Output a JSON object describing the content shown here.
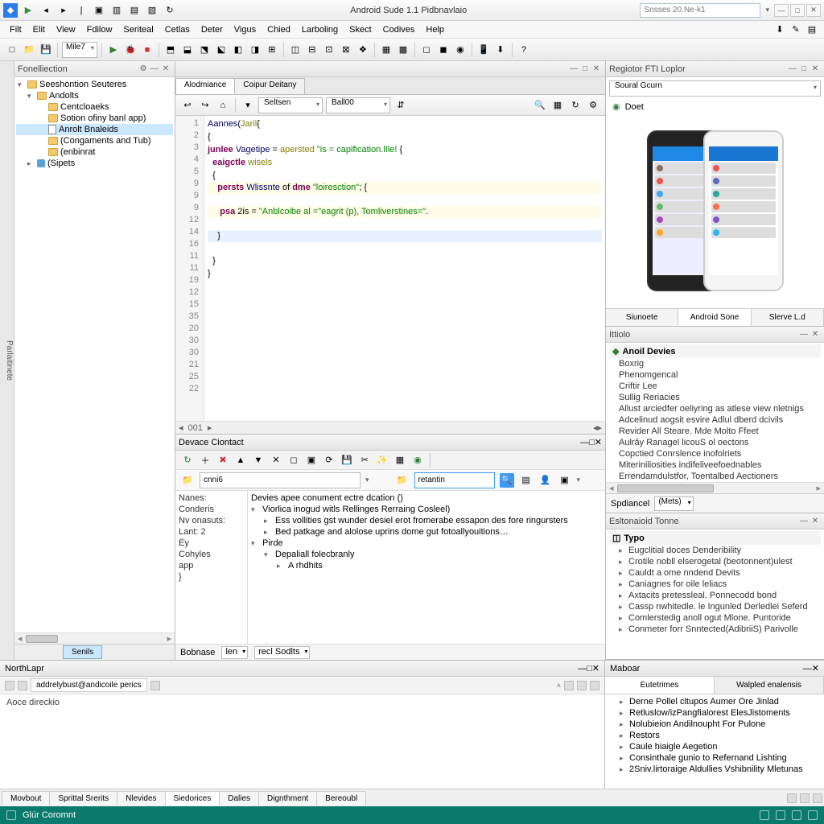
{
  "title": "Android Sude 1.1 Pidbnavlaio",
  "search_placeholder": "Snsses 20.Ne-k1",
  "menu": [
    "Filt",
    "Elit",
    "View",
    "Fdilow",
    "Seriteal",
    "Cetlas",
    "Deter",
    "Vigus",
    "Chied",
    "Larboling",
    "Skect",
    "Codives",
    "Help"
  ],
  "toolbar_combo": "Mile7",
  "left_gutter_label": "Parlaitinete",
  "project_panel": {
    "title": "Fonelliection",
    "tree": [
      {
        "d": 0,
        "exp": true,
        "icon": "folder",
        "label": "Seeshontion Seuteres"
      },
      {
        "d": 1,
        "exp": true,
        "icon": "folder",
        "label": "Andolts"
      },
      {
        "d": 2,
        "exp": false,
        "icon": "folder",
        "label": "Centcloaeks"
      },
      {
        "d": 2,
        "exp": false,
        "icon": "folder",
        "label": "Sotion ofiny banl app)"
      },
      {
        "d": 2,
        "exp": false,
        "icon": "file",
        "label": "Anrolt Bnaleids",
        "sel": true
      },
      {
        "d": 2,
        "exp": false,
        "icon": "folder",
        "label": "(Congaments and Tub)"
      },
      {
        "d": 2,
        "exp": false,
        "icon": "folder",
        "label": "(enbinrat"
      },
      {
        "d": 1,
        "exp": false,
        "icon": "pkg",
        "label": "(Sipets"
      }
    ],
    "bottom_tab": "Senils"
  },
  "editor": {
    "tabs": [
      "Alodmiance",
      "Coipur Deitany"
    ],
    "active_tab": 0,
    "combo1": "Seltsen",
    "combo2": "Ball00",
    "lines": [
      {
        "n": 1,
        "html": "<span class='ty'>Aannes</span>(<span class='an'>Jaril</span>{"
      },
      {
        "n": 2,
        "html": "{"
      },
      {
        "n": 3,
        "html": "<span class='kw'>junlee</span> <span class='ty'>Vagetipe</span> = <span class='an'>apersted</span> <span class='str'>\"is = capification.lIle!</span> {"
      },
      {
        "n": 4,
        "html": "  <span class='kw'>eaigctle</span> <span class='an'>wisels</span>"
      },
      {
        "n": 5,
        "html": "  {"
      },
      {
        "n": 9,
        "html": "    <span class='kw'>persts</span> <span class='ty'>Wlissnte</span> of <span class='kw'>dme</span> <span class='str'>\"loiresction\"</span>; {",
        "cls": "hl2"
      },
      {
        "n": 9,
        "html": "     <span class='kw'>psa</span> 2is = <span class='str'>\"Anblcoibe al =\"eagrit (p), Tomliverstines=\"</span>.",
        "cls": "hl2"
      },
      {
        "n": 9,
        "html": "    }",
        "cls": "hl"
      },
      {
        "n": 12,
        "html": "  }"
      },
      {
        "n": 14,
        "html": "}"
      },
      {
        "n": 16,
        "html": ""
      },
      {
        "n": 11,
        "html": ""
      },
      {
        "n": 11,
        "html": ""
      },
      {
        "n": 19,
        "html": ""
      },
      {
        "n": 12,
        "html": ""
      },
      {
        "n": 15,
        "html": ""
      },
      {
        "n": 35,
        "html": ""
      },
      {
        "n": 20,
        "html": ""
      },
      {
        "n": 30,
        "html": ""
      },
      {
        "n": 30,
        "html": ""
      },
      {
        "n": 21,
        "html": ""
      },
      {
        "n": 25,
        "html": ""
      },
      {
        "n": 22,
        "html": ""
      }
    ],
    "hscroll_label": "001"
  },
  "device_panel": {
    "title": "Devace Ciontact",
    "combo": "cnni6",
    "search": "retantin",
    "left_labels": [
      "Nanes:",
      "Conderis",
      "Nv onasuts:",
      "Lant: 2",
      "Ёy",
      "Cohyles",
      "app",
      "}"
    ],
    "header_row": "Devies apee conument ectre dcation ()",
    "rows": [
      {
        "d": 0,
        "exp": true,
        "label": "Viorlica inogud witls Rellinges Rerraing Cosleel)"
      },
      {
        "d": 1,
        "exp": false,
        "label": "Ess vollities gst wunder desiel erot fromerabe essapon des fore ringursters"
      },
      {
        "d": 1,
        "exp": false,
        "label": "Bed patkage and alolose uprins dome gut fotoallyouitions…"
      },
      {
        "d": 0,
        "exp": true,
        "label": "Pirde"
      },
      {
        "d": 1,
        "exp": true,
        "label": "Depaliall folecbranly"
      },
      {
        "d": 2,
        "exp": false,
        "label": "A rhdhits"
      }
    ],
    "footer": {
      "left": "Bobnase",
      "combo1": "len",
      "combo2": "recl Sodlts"
    }
  },
  "right": {
    "emulator": {
      "title": "Regiotor FTI Loplor",
      "combo": "Soural Gcurn",
      "line": "Doet",
      "tabs": [
        "Siunoete",
        "Android Sone",
        "Slerve L.d"
      ],
      "active_tab": 1
    },
    "todo": {
      "title": "Ittiolo",
      "head": "Anoil Devies",
      "items": [
        "Boxrig",
        "Phenomgencal",
        "Criftir Lee",
        "Sullig Reriacies",
        "Allust arciedfer oeliyring as atlese view nletnigs",
        "Adcelinud aogsit esvire Adlul dberd dcivils",
        "Revider All Steare. Mde Molto Ffeet",
        "Aulrây Ranagel licouS ol oectons",
        "Copctied Conrslence inofolriets",
        "Miteriniliosities indifeliveefoednables",
        "Errendamdulstfor, Toentalbed Aectioners"
      ],
      "bottom_label": "Spdiancel",
      "bottom_combo": "(Mets)"
    },
    "tree_panel": {
      "title": "Esltonaioid Tonne",
      "head": "Typo",
      "items": [
        "Eugclitial doces Denderibility",
        "Crotile nobll elserogetal (beotonnent)ulest",
        "Cauldt a ome nndend Devits",
        "Caniagnes for oile leliacs",
        "Axtacits pretessleal. Ponnecodd bond",
        "Cassp nwhitedle. le Ingunled Derledlei Seferd",
        "Comlerstedig anoll ogut Mlone. Puntoride",
        "Conmeter forr Snntected(AdibriiS) Parivolle"
      ]
    },
    "mobar": {
      "title": "Maboar",
      "tabs": [
        "Eutetrimes",
        "Walpled enalensis"
      ],
      "items": [
        "Derne Pollel cltupos Aumer Ore Jinlad",
        "Retluslow/izPangfialorest ElesJistoments",
        "Nolubieion Andilnoupht For Pulone",
        "Restors",
        "Caule hiaigle Aegetion",
        "Consinthale gunio to Refernand Lishting",
        "2Sniv.lirtoraige Aldullies Vshibnility Mletunas"
      ]
    }
  },
  "northlapr": {
    "title": "NorthLapr",
    "chip": "addrelybust@andicoile perics",
    "body": "Aoce direckio"
  },
  "footer_tabs": [
    "Movbout",
    "Sprittal Srerits",
    "Nlevides",
    "Siedorices",
    "Dalies",
    "Dignthment",
    "Bereoubl"
  ],
  "footer_active": 3,
  "status": "Glúr Coromnt"
}
